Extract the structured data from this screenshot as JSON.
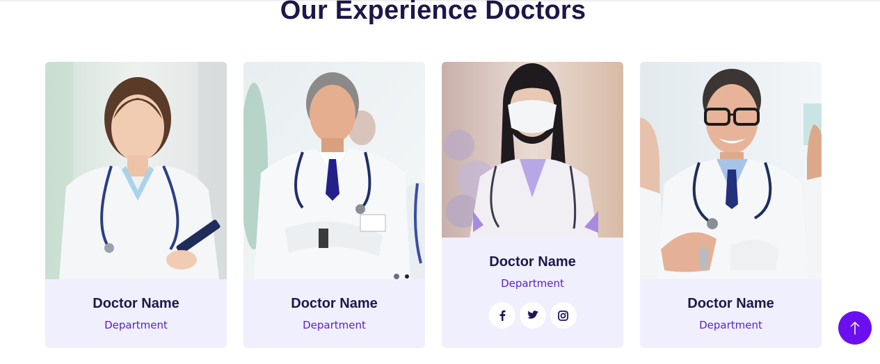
{
  "section": {
    "title": "Our Experience Doctors"
  },
  "doctors": [
    {
      "name": "Doctor Name",
      "department": "Department"
    },
    {
      "name": "Doctor Name",
      "department": "Department"
    },
    {
      "name": "Doctor Name",
      "department": "Department",
      "socials": [
        "f",
        "t",
        "ig"
      ]
    },
    {
      "name": "Doctor Name",
      "department": "Department"
    }
  ],
  "icons": {
    "scroll_top": "arrow-up-icon",
    "facebook": "facebook-icon",
    "twitter": "twitter-icon",
    "instagram": "instagram-icon"
  },
  "colors": {
    "heading": "#1d1748",
    "accent": "#6b0ff0",
    "department": "#5a20c8",
    "card_bg": "#f0effe"
  }
}
